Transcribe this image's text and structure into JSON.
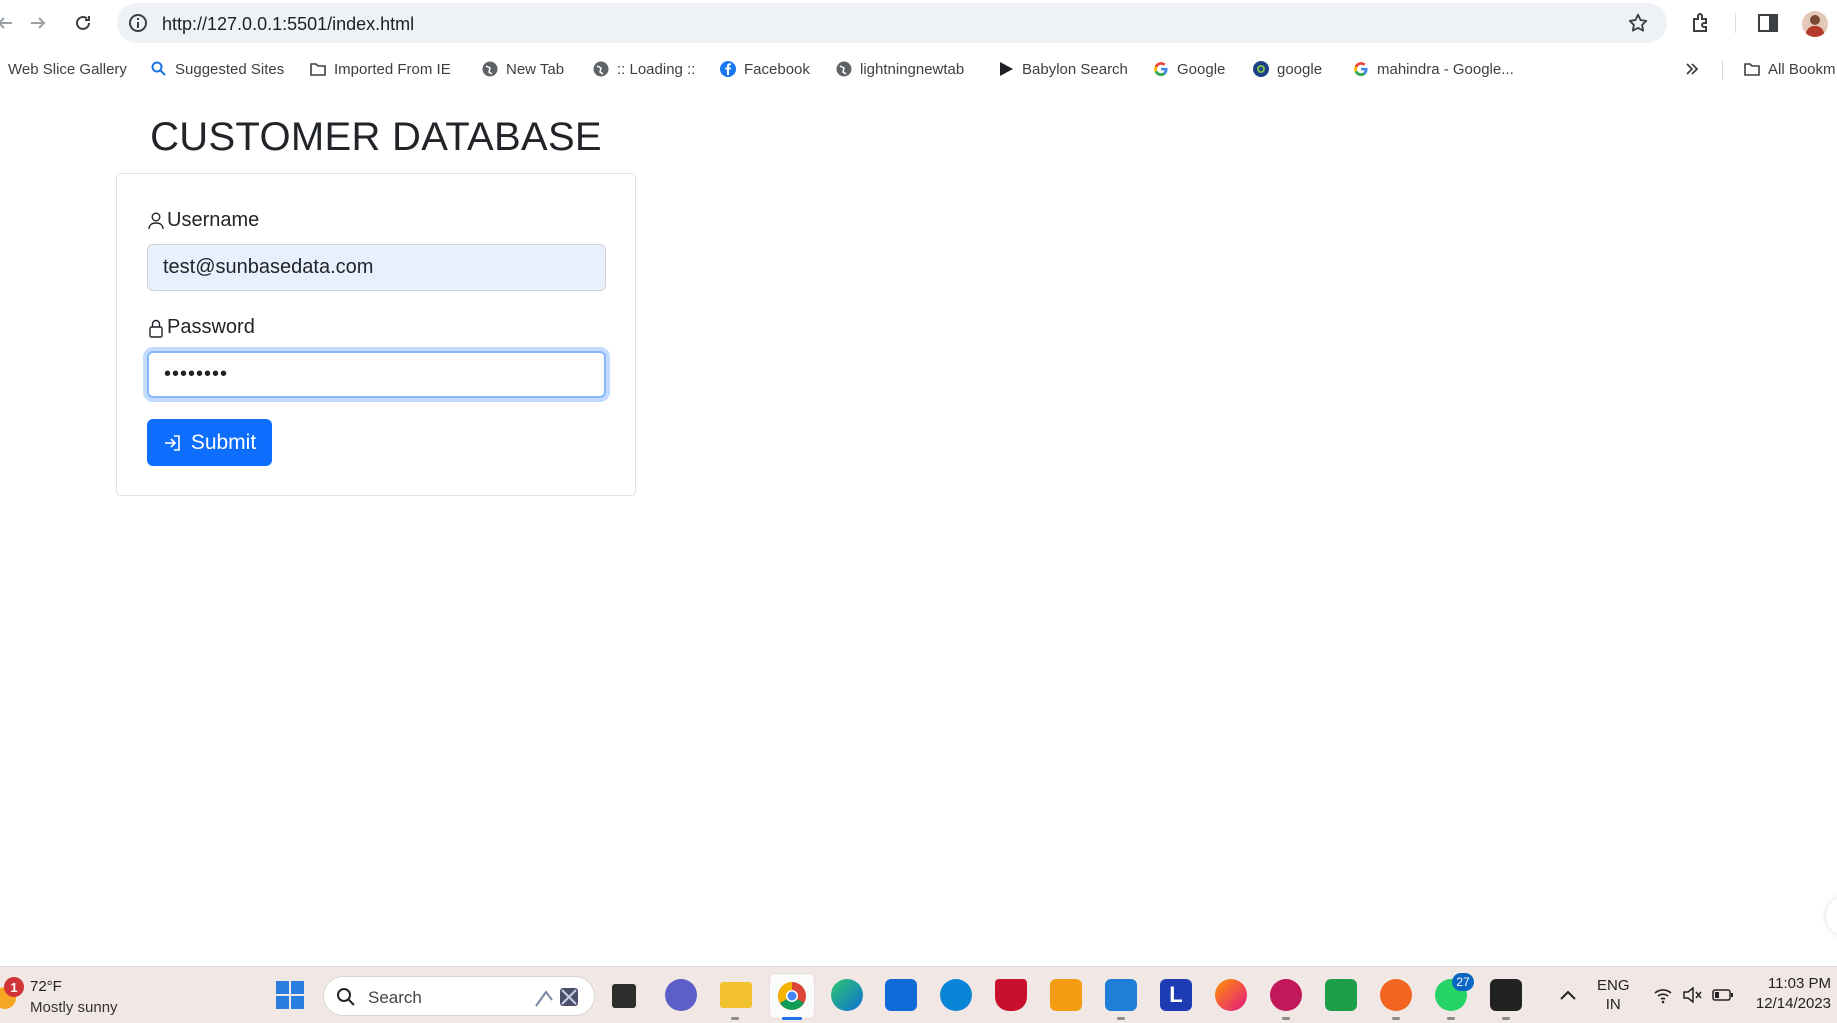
{
  "browser": {
    "url": "http://127.0.0.1:5501/index.html",
    "bookmarks": [
      "Web Slice Gallery",
      "Suggested Sites",
      "Imported From IE",
      "New Tab",
      ":: Loading ::",
      "Facebook",
      "lightningnewtab",
      "Babylon Search",
      "Google",
      "google",
      "mahindra - Google...",
      "All Bookm"
    ]
  },
  "page": {
    "title": "CUSTOMER DATABASE",
    "username_label": "Username",
    "username_value": "test@sunbasedata.com",
    "password_label": "Password",
    "password_value": "••••••••",
    "submit_label": "Submit",
    "accent_color": "#0d6efd"
  },
  "taskbar": {
    "weather_badge": "1",
    "temperature": "72°F",
    "weather": "Mostly sunny",
    "search_placeholder": "Search",
    "whatsapp_badge": "27",
    "language": "ENG",
    "region": "IN",
    "time": "11:03 PM",
    "date": "12/14/2023"
  }
}
